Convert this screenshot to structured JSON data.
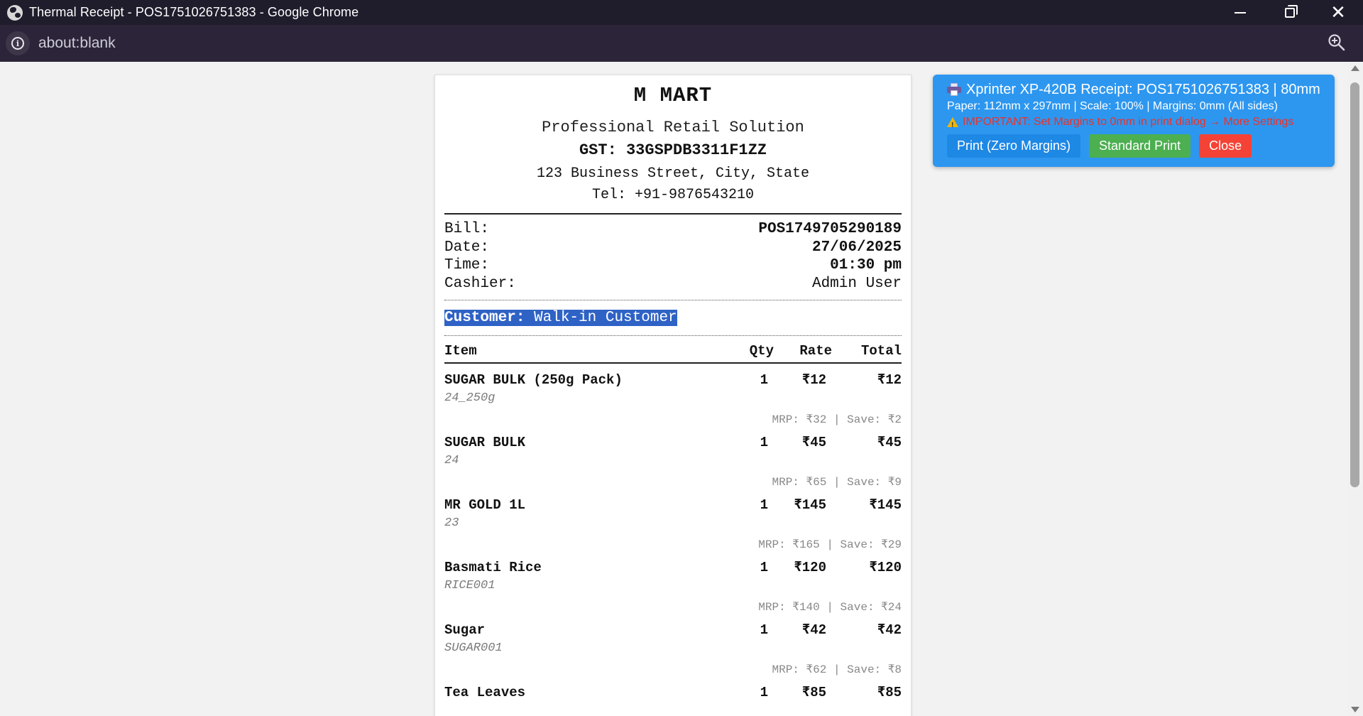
{
  "browser": {
    "window_title": "Thermal Receipt - POS1751026751383 - Google Chrome",
    "url": "about:blank"
  },
  "receipt": {
    "store_name": "M MART",
    "tagline": "Professional Retail Solution",
    "gst": "GST: 33GSPDB3311F1ZZ",
    "address": "123 Business Street, City, State",
    "tel": "Tel: +91-9876543210",
    "meta": [
      {
        "label": "Bill:",
        "value": "POS1749705290189"
      },
      {
        "label": "Date:",
        "value": "27/06/2025"
      },
      {
        "label": "Time:",
        "value": "01:30 pm"
      },
      {
        "label": "Cashier:",
        "value": "Admin User"
      }
    ],
    "customer_label": "Customer:",
    "customer_name": " Walk-in Customer",
    "columns": {
      "item": "Item",
      "qty": "Qty",
      "rate": "Rate",
      "total": "Total"
    },
    "items": [
      {
        "name": "SUGAR BULK (250g Pack)",
        "qty": "1",
        "rate": "₹12",
        "total": "₹12",
        "code": "24_250g",
        "savings": "MRP: ₹32 | Save: ₹2"
      },
      {
        "name": "SUGAR BULK",
        "qty": "1",
        "rate": "₹45",
        "total": "₹45",
        "code": "24",
        "savings": "MRP: ₹65 | Save: ₹9"
      },
      {
        "name": "MR GOLD 1L",
        "qty": "1",
        "rate": "₹145",
        "total": "₹145",
        "code": "23",
        "savings": "MRP: ₹165 | Save: ₹29"
      },
      {
        "name": "Basmati Rice",
        "qty": "1",
        "rate": "₹120",
        "total": "₹120",
        "code": "RICE001",
        "savings": "MRP: ₹140 | Save: ₹24"
      },
      {
        "name": "Sugar",
        "qty": "1",
        "rate": "₹42",
        "total": "₹42",
        "code": "SUGAR001",
        "savings": "MRP: ₹62 | Save: ₹8"
      },
      {
        "name": "Tea Leaves",
        "qty": "1",
        "rate": "₹85",
        "total": "₹85",
        "code": "",
        "savings": ""
      }
    ]
  },
  "print_panel": {
    "title": "Xprinter XP-420B Receipt: POS1751026751383 | 80mm",
    "paper_info": "Paper: 112mm x 297mm | Scale: 100% | Margins: 0mm (All sides)",
    "warning": "IMPORTANT: Set Margins to 0mm in print dialog → More Settings",
    "buttons": {
      "print_zero": "Print (Zero Margins)",
      "standard": "Standard Print",
      "close": "Close"
    },
    "colors": {
      "panel": "#2d97f0",
      "print_zero": "#1e88e5",
      "standard": "#4caf50",
      "close": "#f44336",
      "warning": "#e8322c"
    }
  }
}
